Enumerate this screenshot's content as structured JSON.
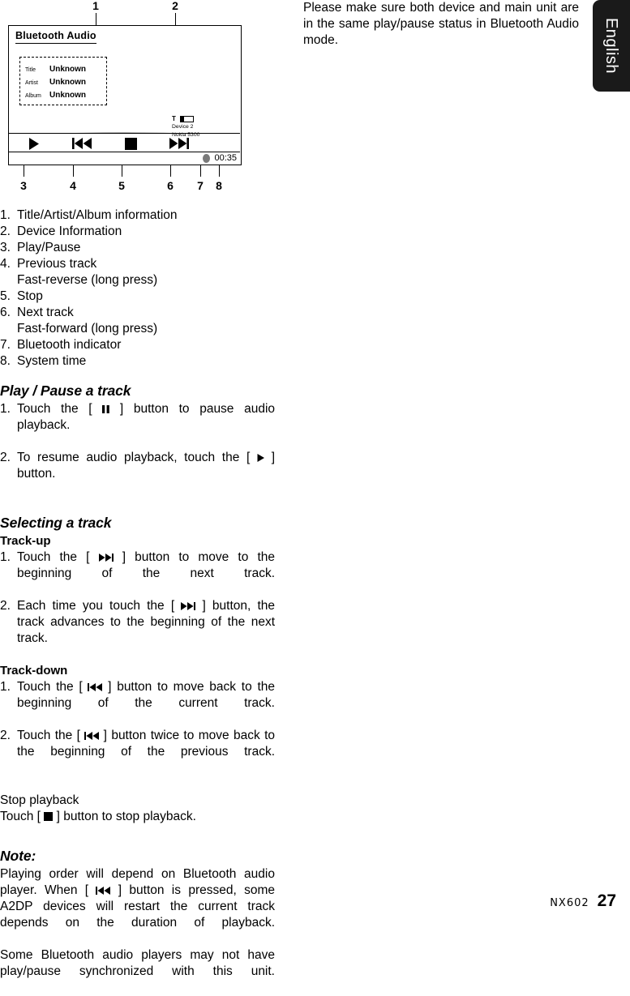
{
  "language_tab": {
    "label": "English"
  },
  "right_column": {
    "paragraph": "Please make sure both device and main unit are in the same play/pause status in Bluetooth Audio mode."
  },
  "figure": {
    "callouts": [
      "1",
      "2",
      "3",
      "4",
      "5",
      "6",
      "7",
      "8"
    ],
    "player": {
      "title": "Bluetooth Audio",
      "metadata": [
        {
          "key": "Title",
          "value": "Unknown"
        },
        {
          "key": "Artist",
          "value": "Unknown"
        },
        {
          "key": "Album",
          "value": "Unknown"
        }
      ],
      "device_info": {
        "signal_icon": "antenna-icon",
        "battery_icon": "battery-icon",
        "line1": "Device 2",
        "line2": "Nokia 5300"
      },
      "controls": [
        {
          "icon": "play-icon"
        },
        {
          "icon": "previous-track-icon"
        },
        {
          "icon": "stop-icon"
        },
        {
          "icon": "next-track-icon"
        }
      ],
      "status": {
        "bluetooth_indicator": "bluetooth-indicator-dot",
        "system_time": "00:35"
      }
    }
  },
  "reference_list": [
    {
      "num": "1.",
      "text": "Title/Artist/Album information"
    },
    {
      "num": "2.",
      "text": "Device Information"
    },
    {
      "num": "3.",
      "text": "Play/Pause"
    },
    {
      "num": "4.",
      "text": "Previous track",
      "sub": "Fast-reverse (long press)"
    },
    {
      "num": "5.",
      "text": "Stop"
    },
    {
      "num": "6.",
      "text": "Next track",
      "sub": "Fast-forward (long press)"
    },
    {
      "num": "7.",
      "text": "Bluetooth indicator"
    },
    {
      "num": "8.",
      "text": "System time"
    }
  ],
  "sections": {
    "play_pause": {
      "heading": "Play / Pause a track",
      "item1_num": "1.",
      "item1_a": "Touch the [",
      "item1_b": "] button to pause audio playback.",
      "item2_num": "2.",
      "item2_a": "To resume audio playback, touch the [",
      "item2_b": "] button."
    },
    "selecting": {
      "heading": "Selecting a track",
      "track_up_heading": "Track-up",
      "up1_num": "1.",
      "up1_a": "Touch the [",
      "up1_b": "] button to move to the beginning of the next track.",
      "up2_num": "2.",
      "up2_a": "Each time you touch the [",
      "up2_b": "] button, the track advances to the beginning of the next track.",
      "track_down_heading": "Track-down",
      "down1_num": "1.",
      "down1_a": "Touch the [",
      "down1_b": "] button to move back to the beginning of the current track.",
      "down2_num": "2.",
      "down2_a": "Touch the [",
      "down2_b": "] button twice to move back to the beginning of the previous track."
    },
    "stop": {
      "heading": "Stop playback",
      "line_a": "Touch [",
      "line_b": "] button to stop playback."
    },
    "note": {
      "heading": "Note:",
      "para1_a": "Playing order will depend on Bluetooth audio player. When [",
      "para1_b": "] button is pressed, some A2DP devices will restart the current track depends on the duration of playback.",
      "para2": "Some Bluetooth audio players may not have play/pause synchronized with this unit."
    }
  },
  "footer": {
    "model": "NX602",
    "page": "27"
  }
}
